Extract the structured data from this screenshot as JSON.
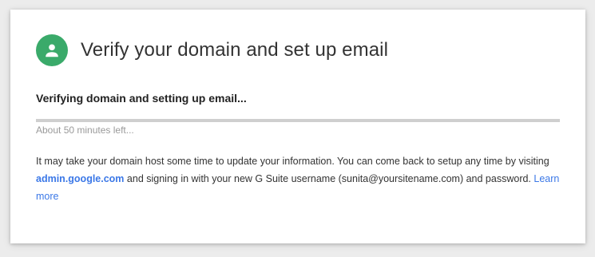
{
  "header": {
    "title": "Verify your domain and set up email",
    "icon": "person-icon",
    "avatar_color": "#3aaa6a"
  },
  "status": {
    "text": "Verifying domain and setting up email...",
    "progress_fraction": 0.0,
    "time_left": "About 50 minutes left..."
  },
  "message": {
    "part1": "It may take your domain host some time to update your information. You can come back to setup any time by visiting ",
    "admin_link": "admin.google.com",
    "part2": " and signing in with your new G Suite username (sunita@yoursitename.com) and password. ",
    "learn_more": "Learn more",
    "link_color": "#3b78e7"
  }
}
